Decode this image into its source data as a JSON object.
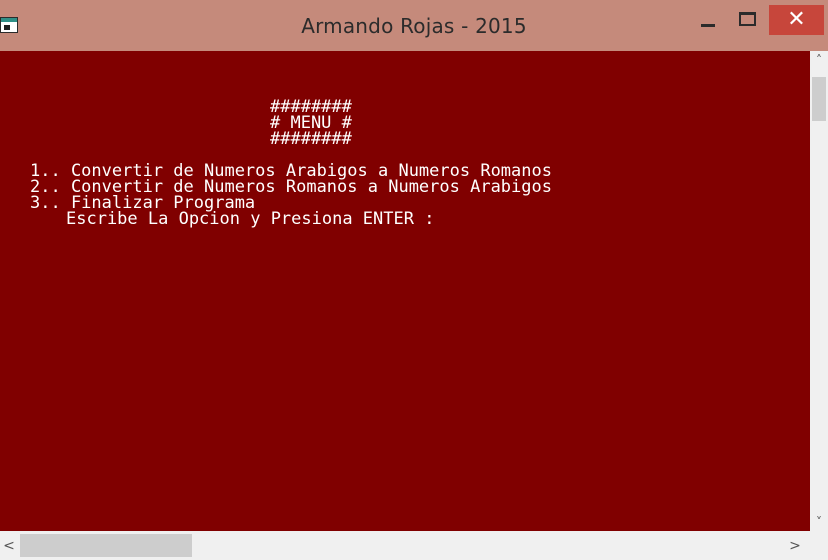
{
  "window": {
    "title": "Armando Rojas - 2015",
    "controls": {
      "minimize_icon": "minimize-icon",
      "maximize_icon": "maximize-icon",
      "close_glyph": "✕"
    },
    "titlebar_color": "#c58a7b",
    "close_color": "#c7463b"
  },
  "console": {
    "background": "#800000",
    "text_color": "#ffffff",
    "menu_border_top": "########",
    "menu_title": "# MENU #",
    "menu_border_bottom": "########",
    "options": [
      "1.. Convertir de Numeros Arabigos a Numeros Romanos",
      "2.. Convertir de Numeros Romanos a Numeros Arabigos",
      "3.. Finalizar Programa"
    ],
    "prompt": "Escribe La Opcion y Presiona ENTER :"
  },
  "scrollbars": {
    "up_glyph": "˄",
    "down_glyph": "˅",
    "left_glyph": "<",
    "right_glyph": ">"
  }
}
